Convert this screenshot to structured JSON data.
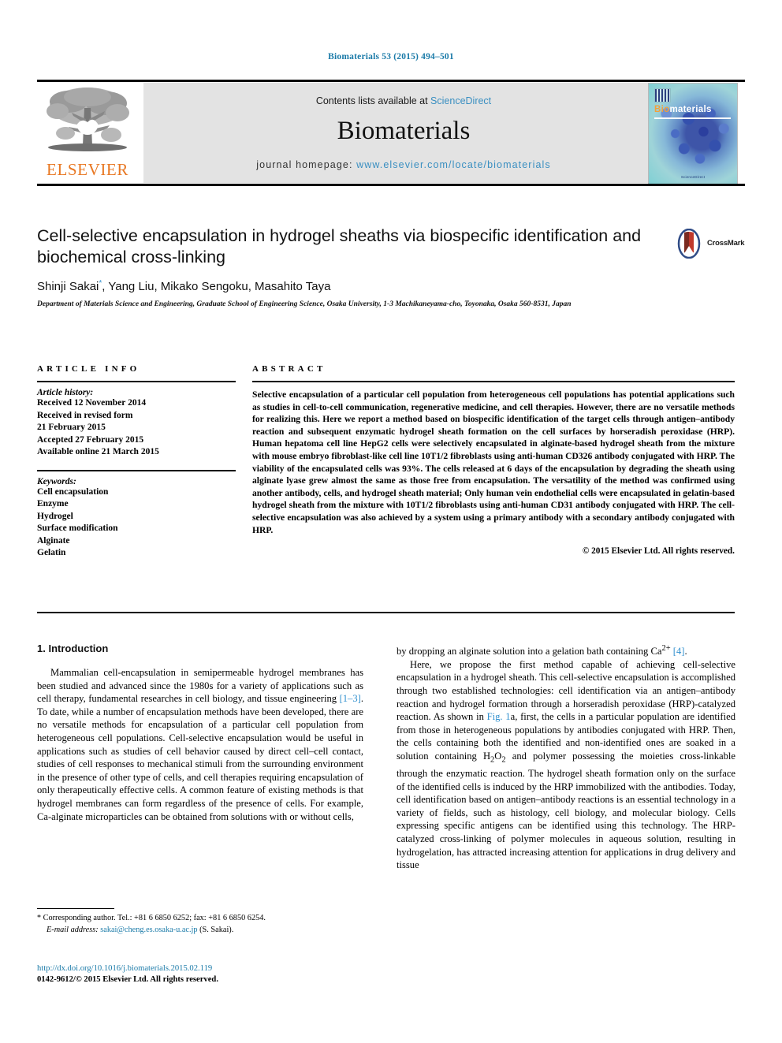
{
  "running_head": "Biomaterials 53 (2015) 494–501",
  "masthead": {
    "contents_prefix": "Contents lists available at ",
    "sciencedirect": "ScienceDirect",
    "journal_name": "Biomaterials",
    "homepage_prefix": "journal homepage: ",
    "homepage_url": "www.elsevier.com/locate/biomaterials",
    "publisher_word": "ELSEVIER",
    "cover": {
      "title_bio": "Bio",
      "title_materials": "materials",
      "footer": "ScienceDirect"
    },
    "accent_link_color": "#3a8fc1",
    "elsevier_orange": "#E87722"
  },
  "article": {
    "title": "Cell-selective encapsulation in hydrogel sheaths via biospecific identification and biochemical cross-linking",
    "authors": "Shinji Sakai",
    "authors_rest": ", Yang Liu, Mikako Sengoku, Masahito Taya",
    "corresponding_marker": "*",
    "affiliation": "Department of Materials Science and Engineering, Graduate School of Engineering Science, Osaka University, 1-3 Machikaneyama-cho, Toyonaka, Osaka 560-8531, Japan",
    "crossmark_label": "CrossMark"
  },
  "article_info": {
    "heading": "ARTICLE INFO",
    "history_label": "Article history:",
    "history": [
      "Received 12 November 2014",
      "Received in revised form",
      "21 February 2015",
      "Accepted 27 February 2015",
      "Available online 21 March 2015"
    ],
    "keywords_label": "Keywords:",
    "keywords": [
      "Cell encapsulation",
      "Enzyme",
      "Hydrogel",
      "Surface modification",
      "Alginate",
      "Gelatin"
    ]
  },
  "abstract": {
    "heading": "ABSTRACT",
    "text": "Selective encapsulation of a particular cell population from heterogeneous cell populations has potential applications such as studies in cell-to-cell communication, regenerative medicine, and cell therapies. However, there are no versatile methods for realizing this. Here we report a method based on biospecific identification of the target cells through antigen–antibody reaction and subsequent enzymatic hydrogel sheath formation on the cell surfaces by horseradish peroxidase (HRP). Human hepatoma cell line HepG2 cells were selectively encapsulated in alginate-based hydrogel sheath from the mixture with mouse embryo fibroblast-like cell line 10T1/2 fibroblasts using anti-human CD326 antibody conjugated with HRP. The viability of the encapsulated cells was 93%. The cells released at 6 days of the encapsulation by degrading the sheath using alginate lyase grew almost the same as those free from encapsulation. The versatility of the method was confirmed using another antibody, cells, and hydrogel sheath material; Only human vein endothelial cells were encapsulated in gelatin-based hydrogel sheath from the mixture with 10T1/2 fibroblasts using anti-human CD31 antibody conjugated with HRP. The cell-selective encapsulation was also achieved by a system using a primary antibody with a secondary antibody conjugated with HRP.",
    "copyright": "© 2015 Elsevier Ltd. All rights reserved."
  },
  "body": {
    "section_number_title": "1. Introduction",
    "left_para_1_a": "Mammalian cell-encapsulation in semipermeable hydrogel membranes has been studied and advanced since the 1980s for a variety of applications such as cell therapy, fundamental researches in cell biology, and tissue engineering ",
    "left_para_1_ref": "[1–3]",
    "left_para_1_b": ". To date, while a number of encapsulation methods have been developed, there are no versatile methods for encapsulation of a particular cell population from heterogeneous cell populations. Cell-selective encapsulation would be useful in applications such as studies of cell behavior caused by direct cell–cell contact, studies of cell responses to mechanical stimuli from the surrounding environment in the presence of other type of cells, and cell therapies requiring encapsulation of only therapeutically effective cells. A common feature of existing methods is that hydrogel membranes can form regardless of the presence of cells. For example, Ca-alginate microparticles can be obtained from solutions with or without cells,",
    "right_para_0_a": "by dropping an alginate solution into a gelation bath containing Ca",
    "right_para_0_sup": "2+",
    "right_para_0_ref": "[4]",
    "right_para_0_b": ".",
    "right_para_1_a": "Here, we propose the first method capable of achieving cell-selective encapsulation in a hydrogel sheath. This cell-selective encapsulation is accomplished through two established technologies: cell identification via an antigen–antibody reaction and hydrogel formation through a horseradish peroxidase (HRP)-catalyzed reaction. As shown in ",
    "right_para_1_figref": "Fig. 1",
    "right_para_1_b": "a, first, the cells in a particular population are identified from those in heterogeneous populations by antibodies conjugated with HRP. Then, the cells containing both the identified and non-identified ones are soaked in a solution containing H",
    "right_para_1_sub1": "2",
    "right_para_1_c": "O",
    "right_para_1_sub2": "2",
    "right_para_1_d": " and polymer possessing the moieties cross-linkable through the enzymatic reaction. The hydrogel sheath formation only on the surface of the identified cells is induced by the HRP immobilized with the antibodies. Today, cell identification based on antigen–antibody reactions is an essential technology in a variety of fields, such as histology, cell biology, and molecular biology. Cells expressing specific antigens can be identified using this technology. The HRP-catalyzed cross-linking of polymer molecules in aqueous solution, resulting in hydrogelation, has attracted increasing attention for applications in drug delivery and tissue"
  },
  "footnote": {
    "star": "*",
    "corresponding": " Corresponding author. Tel.: +81 6 6850 6252; fax: +81 6 6850 6254.",
    "email_label": "E-mail address:",
    "email": "sakai@cheng.es.osaka-u.ac.jp",
    "email_owner": " (S. Sakai)."
  },
  "doi": {
    "url": "http://dx.doi.org/10.1016/j.biomaterials.2015.02.119",
    "issn_line": "0142-9612/© 2015 Elsevier Ltd. All rights reserved."
  }
}
